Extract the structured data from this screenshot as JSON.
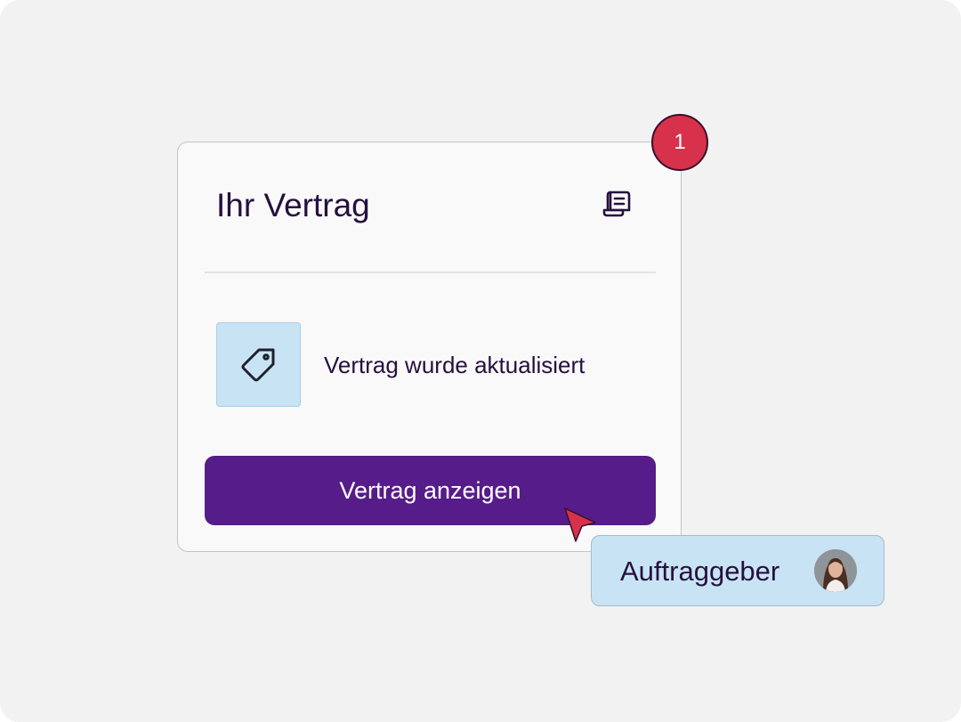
{
  "card": {
    "title": "Ihr Vertrag",
    "doc_icon": "document-icon",
    "notice": {
      "icon": "tag-icon",
      "text": "Vertrag wurde aktualisiert"
    },
    "button_label": "Vertrag anzeigen"
  },
  "badge": {
    "count": "1",
    "color": "#d7314b"
  },
  "cursor": {
    "icon": "pointer-cursor-icon",
    "color": "#d7314b"
  },
  "user_chip": {
    "label": "Auftraggeber",
    "avatar": "user-avatar"
  },
  "colors": {
    "background": "#f2f2f2",
    "card_background": "#f9f9f9",
    "primary": "#561c8a",
    "text": "#26103f",
    "light_blue": "#c8e4f4"
  }
}
